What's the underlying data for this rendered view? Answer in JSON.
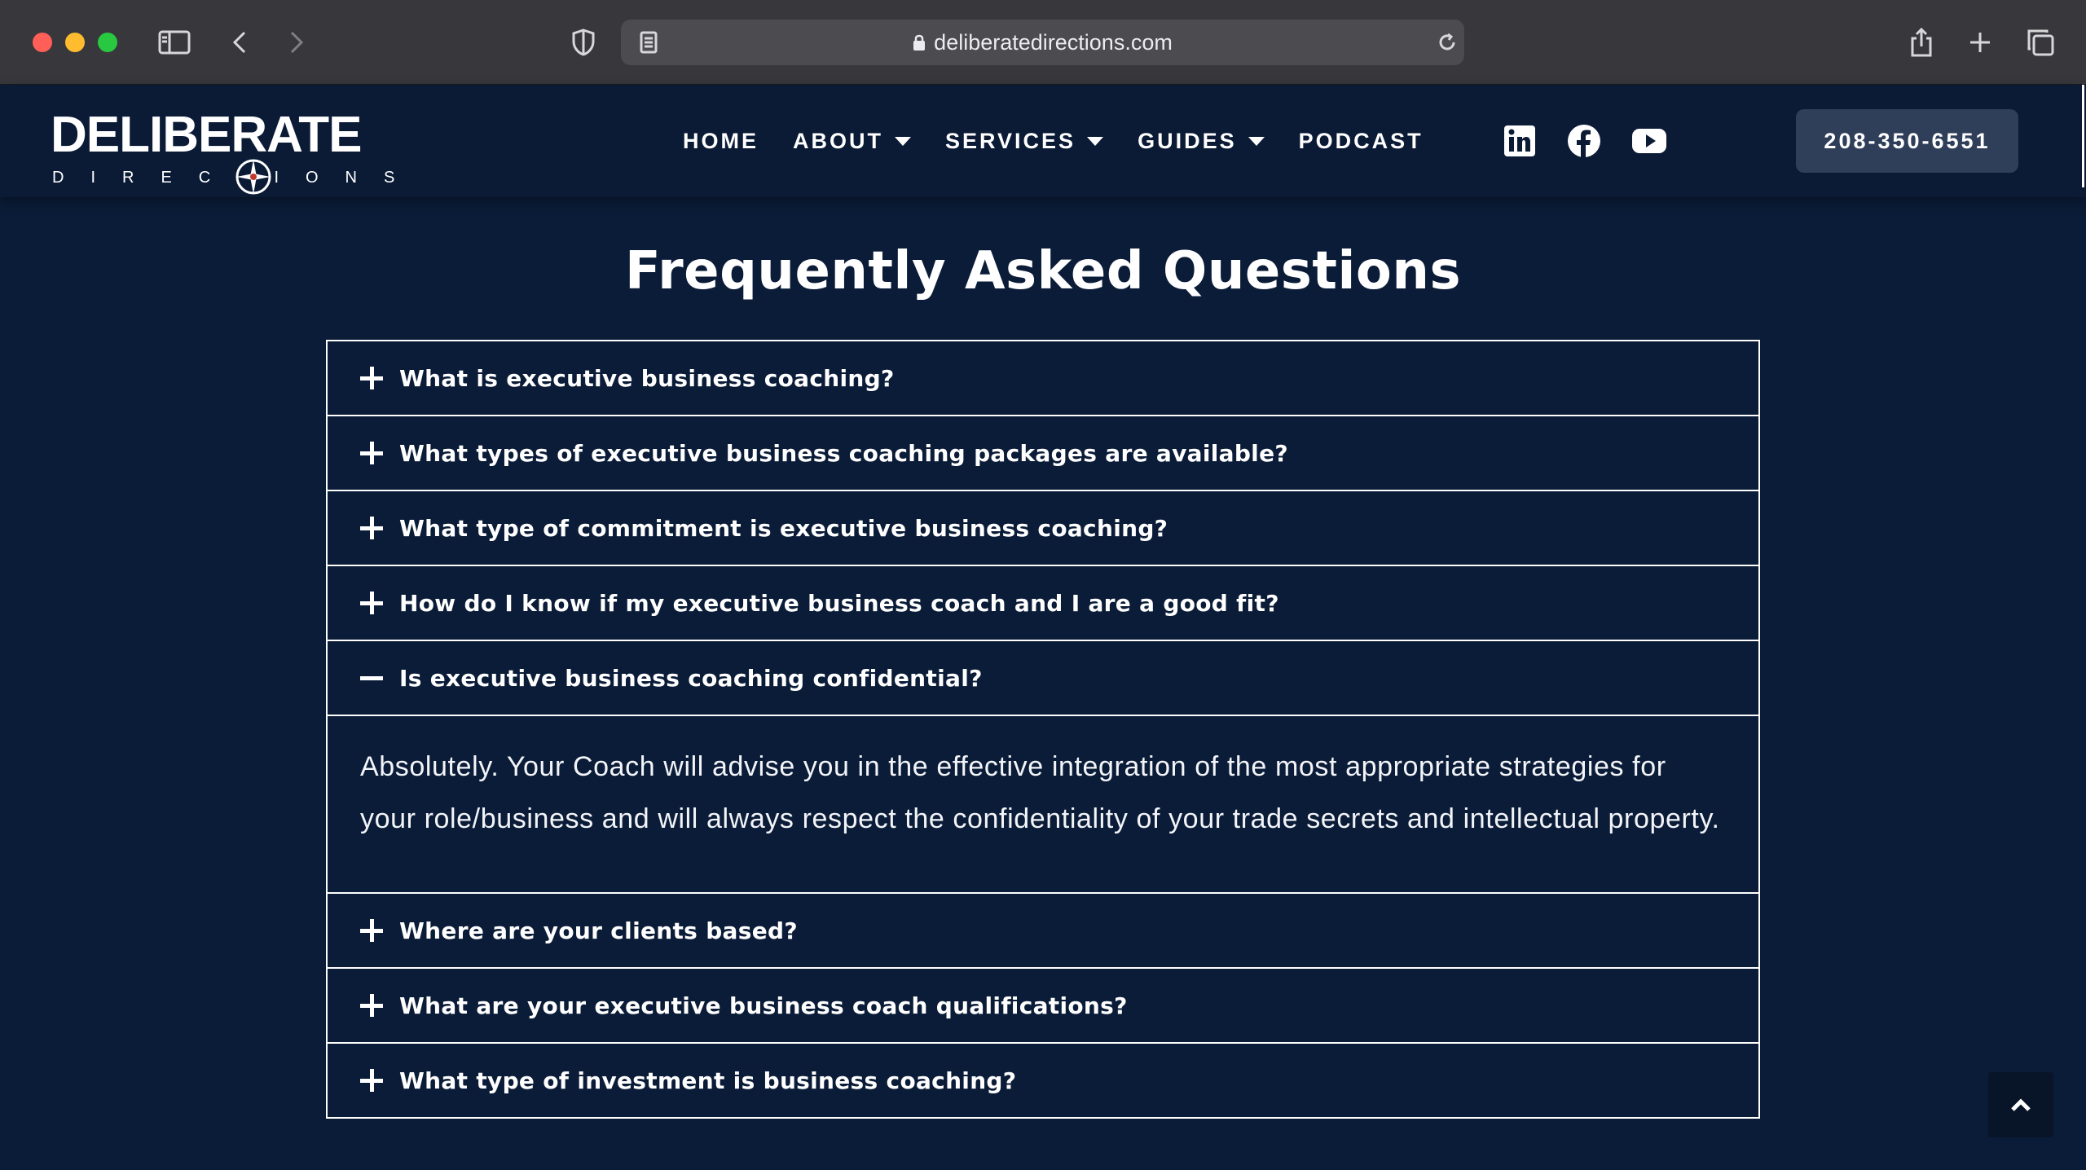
{
  "browser": {
    "url": "deliberatedirections.com"
  },
  "header": {
    "logo_main": "DELIBERATE",
    "logo_sub": "DIRECTIONS",
    "nav": [
      {
        "label": "HOME",
        "dropdown": false
      },
      {
        "label": "ABOUT",
        "dropdown": true
      },
      {
        "label": "SERVICES",
        "dropdown": true
      },
      {
        "label": "GUIDES",
        "dropdown": true
      },
      {
        "label": "PODCAST",
        "dropdown": false
      }
    ],
    "social": [
      "linkedin-icon",
      "facebook-icon",
      "youtube-icon"
    ],
    "phone": "208-350-6551"
  },
  "faq": {
    "title": "Frequently Asked Questions",
    "items": [
      {
        "question": "What is executive business coaching?",
        "expanded": false
      },
      {
        "question": "What types of executive business coaching packages are available?",
        "expanded": false
      },
      {
        "question": "What type of commitment is executive business coaching?",
        "expanded": false
      },
      {
        "question": "How do I know if my executive business coach and I are a good fit?",
        "expanded": false
      },
      {
        "question": "Is executive business coaching confidential?",
        "expanded": true,
        "answer": "Absolutely. Your Coach will advise you in the effective integration of the most appropriate strategies for your role/business and will always respect the confidentiality of your trade secrets and intellectual property."
      },
      {
        "question": "Where are your clients based?",
        "expanded": false
      },
      {
        "question": "What are your executive business coach qualifications?",
        "expanded": false
      },
      {
        "question": "What type of investment is business coaching?",
        "expanded": false
      }
    ]
  },
  "colors": {
    "page_bg": "#0b1c38",
    "header_bg": "#0b1b36",
    "phone_button_bg": "#2f3f5a"
  }
}
